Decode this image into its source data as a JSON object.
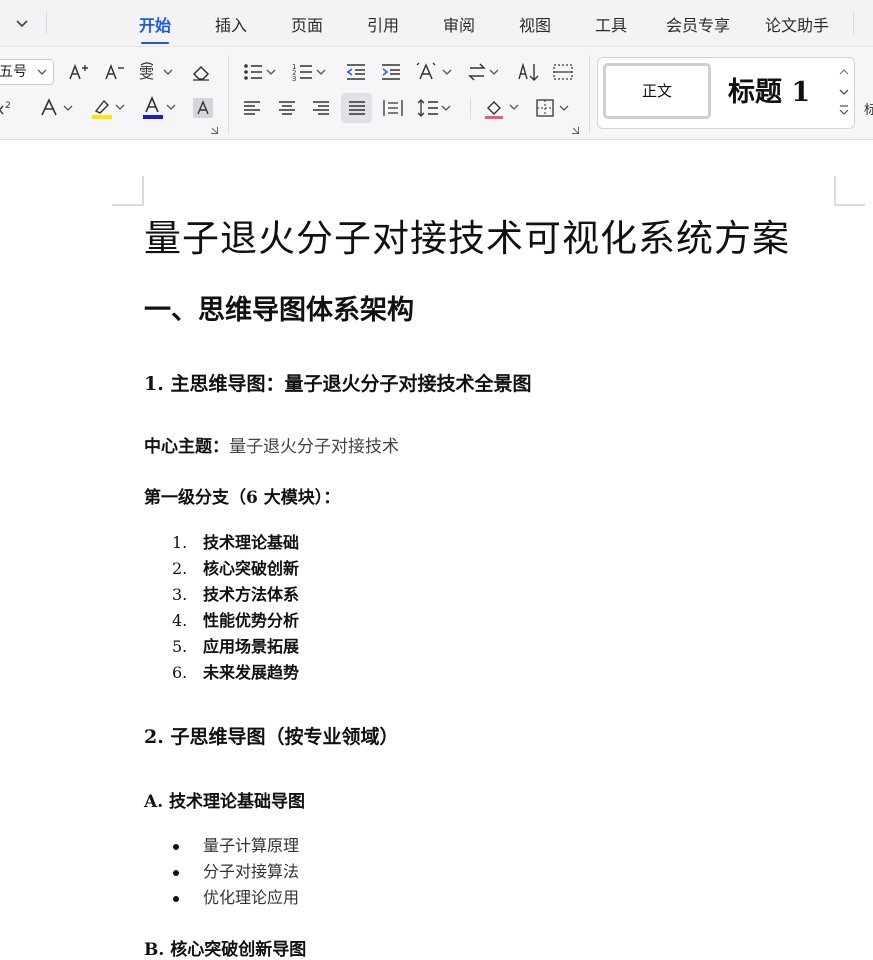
{
  "menu": {
    "tabs": [
      "开始",
      "插入",
      "页面",
      "引用",
      "审阅",
      "视图",
      "工具",
      "会员专享",
      "论文助手"
    ],
    "active_tab": "开始"
  },
  "ribbon": {
    "font_size_value": "五号",
    "styles": {
      "normal": "正文",
      "heading1": "标题 1"
    },
    "overflow_glyph": "标",
    "accent_color": "#1e5adc",
    "highlight_color": "#ffe600",
    "font_color": "#1a1ad6"
  },
  "document": {
    "title": "量子退火分子对接技术可视化系统方案",
    "section1": "一、思维导图体系架构",
    "subsection1": "1. 主思维导图：量子退火分子对接技术全景图",
    "center_topic_label": "中心主题：",
    "center_topic_value": "量子退火分子对接技术",
    "level1_label": "第一级分支（6 大模块）：",
    "level1_items": [
      {
        "num": "1.",
        "text": "技术理论基础"
      },
      {
        "num": "2.",
        "text": "核心突破创新"
      },
      {
        "num": "3.",
        "text": "技术方法体系"
      },
      {
        "num": "4.",
        "text": "性能优势分析"
      },
      {
        "num": "5.",
        "text": "应用场景拓展"
      },
      {
        "num": "6.",
        "text": "未来发展趋势"
      }
    ],
    "subsection2": "2. 子思维导图（按专业领域）",
    "subsectionA": "A. 技术理论基础导图",
    "a_items": [
      "量子计算原理",
      "分子对接算法",
      "优化理论应用"
    ],
    "subsectionB": "B. 核心突破创新导图"
  }
}
